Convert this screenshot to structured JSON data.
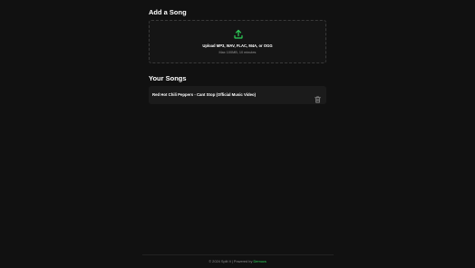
{
  "add_section": {
    "title": "Add a Song",
    "upload_text": "Upload MP3, WAV, FLAC, M4A, or OGG",
    "upload_limits": "Max 100MB, 10 minutes",
    "icon": "upload-icon"
  },
  "songs_section": {
    "title": "Your Songs",
    "songs": [
      {
        "title": "Red Hot Chili Peppers - Cant Stop (Official Music Video)",
        "action_icon": "trash-icon"
      }
    ]
  },
  "footer": {
    "copyright": "© 2024 Split It | Powered by ",
    "powered_by": "Demucs"
  },
  "colors": {
    "background": "#111111",
    "accent": "#2fd25a",
    "card": "#1b1b1b"
  }
}
